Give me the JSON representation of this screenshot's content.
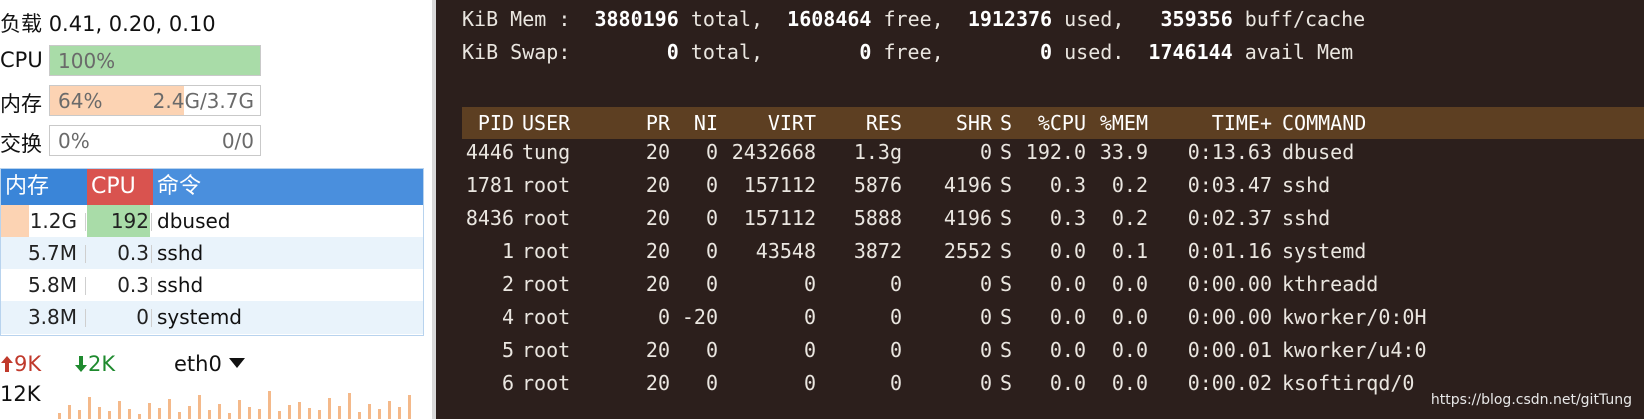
{
  "monitor": {
    "load_label": "负载",
    "load_values": "0.41, 0.20, 0.10",
    "cpu": {
      "label": "CPU",
      "text": "100%",
      "fraction": 1.0,
      "color": "#a9dca8"
    },
    "memory": {
      "label": "内存",
      "text": "64%",
      "detail": "2.4G/3.7G",
      "fraction": 0.64,
      "color": "#fcd3b3"
    },
    "swap": {
      "label": "交换",
      "text": "0%",
      "detail": "0/0",
      "fraction": 0.0
    },
    "process_table": {
      "headers": {
        "mem": "内存",
        "cpu": "CPU",
        "cmd": "命令"
      },
      "header_colors": {
        "mem": "#3a85d8",
        "cpu": "#d9534f",
        "cmd": "#4a8fdd"
      },
      "rows": [
        {
          "mem": "1.2G",
          "mem_fraction": 0.33,
          "cpu": "192",
          "cpu_fraction": 0.96,
          "cmd": "dbused"
        },
        {
          "mem": "5.7M",
          "mem_fraction": 0.0,
          "cpu": "0.3",
          "cpu_fraction": 0.0,
          "cmd": "sshd"
        },
        {
          "mem": "5.8M",
          "mem_fraction": 0.0,
          "cpu": "0.3",
          "cpu_fraction": 0.0,
          "cmd": "sshd"
        },
        {
          "mem": "3.8M",
          "mem_fraction": 0.0,
          "cpu": "0",
          "cpu_fraction": 0.0,
          "cmd": "systemd"
        }
      ]
    },
    "network": {
      "upload": "9K",
      "download": "2K",
      "interface": "eth0",
      "scale_label": "12K",
      "upload_icon": "arrow-up-icon",
      "download_icon": "arrow-down-icon",
      "dropdown_icon": "caret-down-icon"
    }
  },
  "terminal": {
    "mem_line": {
      "label": "KiB Mem :",
      "total": "3880196",
      "total_label": "total,",
      "free": "1608464",
      "free_label": "free,",
      "used": "1912376",
      "used_label": "used,",
      "cache": "359356",
      "cache_label": "buff/cache"
    },
    "swap_line": {
      "label": "KiB Swap:",
      "total": "0",
      "total_label": "total,",
      "free": "0",
      "free_label": "free,",
      "used": "0",
      "used_label": "used.",
      "avail": "1746144",
      "avail_label": "avail Mem"
    },
    "columns": [
      "PID",
      "USER",
      "PR",
      "NI",
      "VIRT",
      "RES",
      "SHR",
      "S",
      "%CPU",
      "%MEM",
      "TIME+",
      "COMMAND"
    ],
    "processes": [
      [
        "4446",
        "tung",
        "20",
        "0",
        "2432668",
        "1.3g",
        "0",
        "S",
        "192.0",
        "33.9",
        "0:13.63",
        "dbused"
      ],
      [
        "1781",
        "root",
        "20",
        "0",
        "157112",
        "5876",
        "4196",
        "S",
        "0.3",
        "0.2",
        "0:03.47",
        "sshd"
      ],
      [
        "8436",
        "root",
        "20",
        "0",
        "157112",
        "5888",
        "4196",
        "S",
        "0.3",
        "0.2",
        "0:02.37",
        "sshd"
      ],
      [
        "1",
        "root",
        "20",
        "0",
        "43548",
        "3872",
        "2552",
        "S",
        "0.0",
        "0.1",
        "0:01.16",
        "systemd"
      ],
      [
        "2",
        "root",
        "20",
        "0",
        "0",
        "0",
        "0",
        "S",
        "0.0",
        "0.0",
        "0:00.00",
        "kthreadd"
      ],
      [
        "4",
        "root",
        "0",
        "-20",
        "0",
        "0",
        "0",
        "S",
        "0.0",
        "0.0",
        "0:00.00",
        "kworker/0:0H"
      ],
      [
        "5",
        "root",
        "20",
        "0",
        "0",
        "0",
        "0",
        "S",
        "0.0",
        "0.0",
        "0:00.01",
        "kworker/u4:0"
      ],
      [
        "6",
        "root",
        "20",
        "0",
        "0",
        "0",
        "0",
        "S",
        "0.0",
        "0.0",
        "0:00.02",
        "ksoftirqd/0"
      ]
    ],
    "header_bg": "#5d3f22",
    "background": "#2c1f1c"
  },
  "watermark": "https://blog.csdn.net/gitTung"
}
